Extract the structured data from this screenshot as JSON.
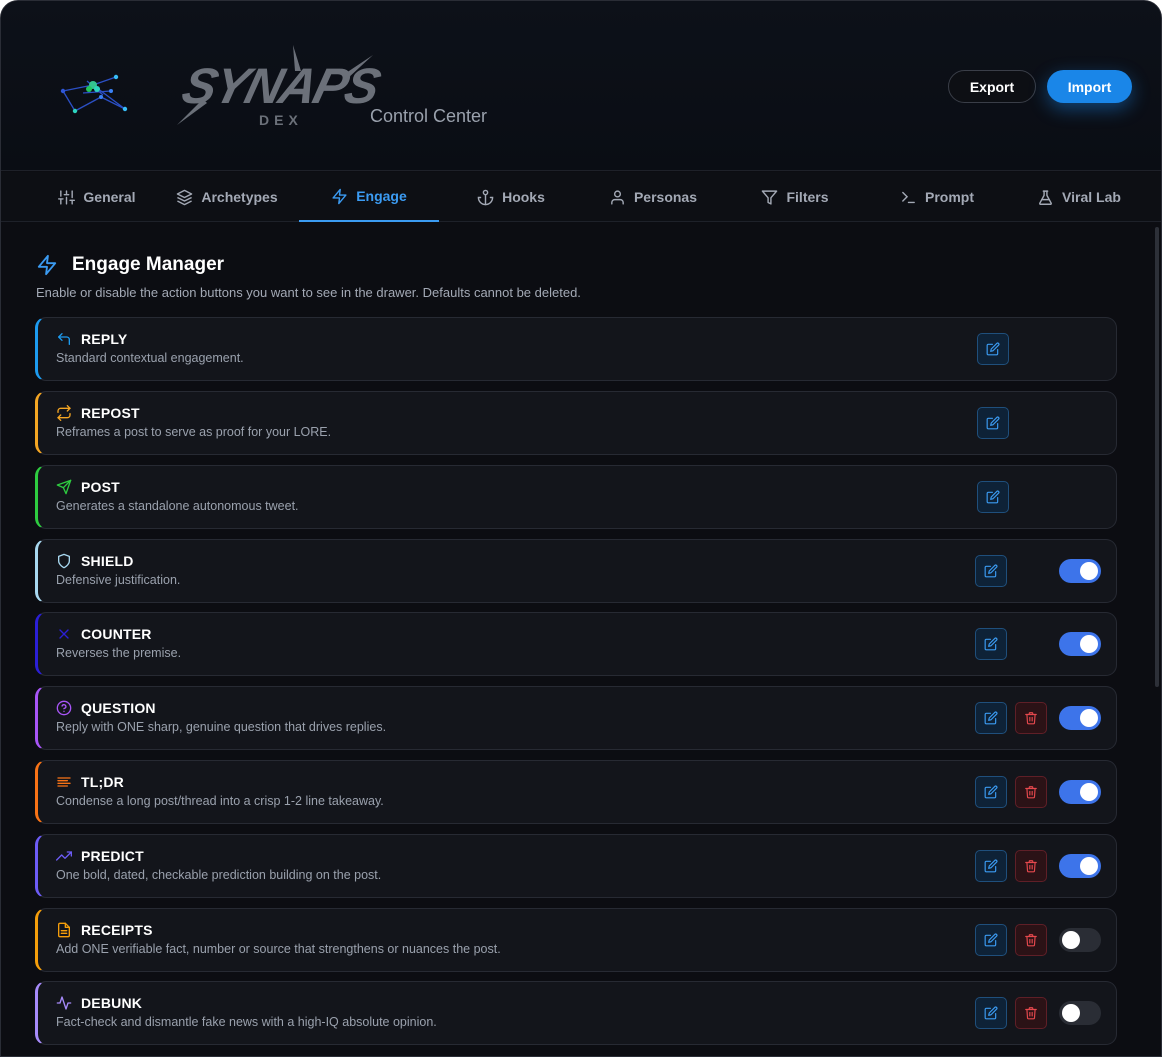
{
  "header": {
    "brand_name": "SYNAPS",
    "brand_sub": "DEX",
    "subtitle": "Control Center",
    "export_label": "Export",
    "import_label": "Import"
  },
  "tabs": [
    {
      "label": "General",
      "icon": "sliders-icon",
      "active": false
    },
    {
      "label": "Archetypes",
      "icon": "layers-icon",
      "active": false
    },
    {
      "label": "Engage",
      "icon": "bolt-icon",
      "active": true
    },
    {
      "label": "Hooks",
      "icon": "anchor-icon",
      "active": false
    },
    {
      "label": "Personas",
      "icon": "user-icon",
      "active": false
    },
    {
      "label": "Filters",
      "icon": "filter-icon",
      "active": false
    },
    {
      "label": "Prompt",
      "icon": "terminal-icon",
      "active": false
    },
    {
      "label": "Viral Lab",
      "icon": "flask-icon",
      "active": false
    }
  ],
  "manager": {
    "title": "Engage Manager",
    "description": "Enable or disable the action buttons you want to see in the drawer. Defaults cannot be deleted."
  },
  "actions": [
    {
      "name": "REPLY",
      "description": "Standard contextual engagement.",
      "icon": "reply-icon",
      "color": "#1d9bf0",
      "deletable": false,
      "has_toggle": false,
      "enabled": true
    },
    {
      "name": "REPOST",
      "description": "Reframes a post to serve as proof for your LORE.",
      "icon": "repost-icon",
      "color": "#f5a623",
      "deletable": false,
      "has_toggle": false,
      "enabled": true
    },
    {
      "name": "POST",
      "description": "Generates a standalone autonomous tweet.",
      "icon": "send-icon",
      "color": "#2ecc40",
      "deletable": false,
      "has_toggle": false,
      "enabled": true
    },
    {
      "name": "SHIELD",
      "description": "Defensive justification.",
      "icon": "shield-icon",
      "color": "#a8d8f0",
      "deletable": false,
      "has_toggle": true,
      "enabled": true
    },
    {
      "name": "COUNTER",
      "description": "Reverses the premise.",
      "icon": "x-icon",
      "color": "#2b1fd6",
      "deletable": false,
      "has_toggle": true,
      "enabled": true
    },
    {
      "name": "QUESTION",
      "description": "Reply with ONE sharp, genuine question that drives replies.",
      "icon": "question-icon",
      "color": "#a855f7",
      "deletable": true,
      "has_toggle": true,
      "enabled": true
    },
    {
      "name": "TL;DR",
      "description": "Condense a long post/thread into a crisp 1-2 line takeaway.",
      "icon": "align-left-icon",
      "color": "#f97316",
      "deletable": true,
      "has_toggle": true,
      "enabled": true
    },
    {
      "name": "PREDICT",
      "description": "One bold, dated, checkable prediction building on the post.",
      "icon": "trending-up-icon",
      "color": "#6d5cf6",
      "deletable": true,
      "has_toggle": true,
      "enabled": true
    },
    {
      "name": "RECEIPTS",
      "description": "Add ONE verifiable fact, number or source that strengthens or nuances the post.",
      "icon": "file-text-icon",
      "color": "#f59e0b",
      "deletable": true,
      "has_toggle": true,
      "enabled": false
    },
    {
      "name": "DEBUNK",
      "description": "Fact-check and dismantle fake news with a high-IQ absolute opinion.",
      "icon": "activity-icon",
      "color": "#a78bfa",
      "deletable": true,
      "has_toggle": true,
      "enabled": false
    }
  ]
}
